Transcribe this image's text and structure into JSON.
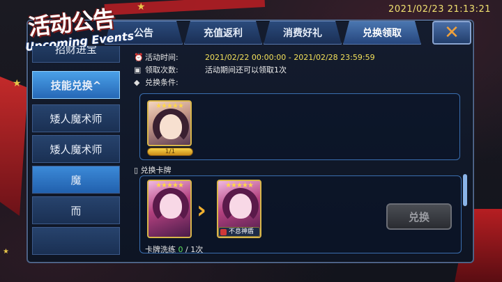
{
  "clock": "2021/02/23  21:13:21",
  "logo": {
    "title": "活动公告",
    "subtitle": "Upcoming Events"
  },
  "tabs": [
    {
      "label": "公告"
    },
    {
      "label": "充值返利"
    },
    {
      "label": "消费好礼"
    },
    {
      "label": "兑换领取"
    }
  ],
  "sidebar": [
    {
      "label": "招财进宝"
    },
    {
      "label": "技能兑换^"
    },
    {
      "label": "矮人魔术师"
    },
    {
      "label": "矮人魔术师"
    },
    {
      "label": "魔"
    },
    {
      "label": "而"
    }
  ],
  "info": {
    "time_label": "活动时间:",
    "time_value": "2021/02/22 00:00:00 - 2021/02/28 23:59:59",
    "count_label": "领取次数:",
    "count_value": "活动期间还可以领取1次",
    "cond_label": "兑换条件:"
  },
  "condition_card": {
    "stars": "★★★★★",
    "progress": "1/1"
  },
  "exchange": {
    "section_label": "兑换卡牌",
    "card_from_stars": "★★★★★",
    "card_to_stars": "★★★★★",
    "card_to_tag": "不息神盾",
    "button_label": "兑换",
    "wash_label": "卡牌洗练",
    "wash_current": "0",
    "wash_total": " / 1次"
  }
}
